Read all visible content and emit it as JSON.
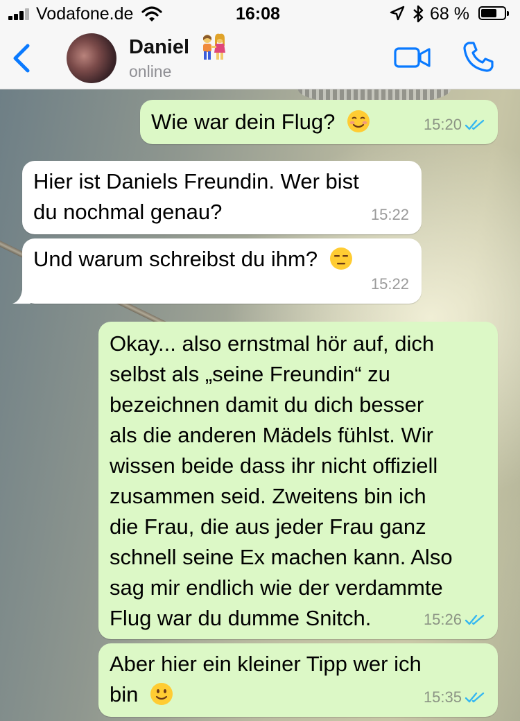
{
  "status_bar": {
    "carrier": "Vodafone.de",
    "time": "16:08",
    "battery_percent": "68 %",
    "battery_level": 0.68,
    "icons": [
      "signal-icon",
      "wifi-icon",
      "location-arrow-icon",
      "bluetooth-icon",
      "battery-icon"
    ]
  },
  "header": {
    "back_icon": "chevron-left-icon",
    "contact_name": "Daniel",
    "name_emoji": "couple-emoji",
    "presence": "online",
    "video_icon": "video-camera-icon",
    "call_icon": "phone-icon",
    "accent_color": "#0a7aff"
  },
  "messages": [
    {
      "direction": "outgoing",
      "lines": [
        "Wie war dein Flug?"
      ],
      "emoji": "smiling-face-emoji",
      "time": "15:20",
      "read": true
    },
    {
      "direction": "incoming",
      "lines": [
        "Hier ist Daniels Freundin. Wer bist",
        "du nochmal genau?"
      ],
      "time": "15:22"
    },
    {
      "direction": "incoming",
      "lines": [
        "Und warum schreibst du ihm?"
      ],
      "emoji": "expressionless-face-emoji",
      "time": "15:22"
    },
    {
      "direction": "outgoing",
      "lines": [
        "Okay... also ernstmal hör auf, dich",
        "selbst als „seine Freundin“ zu",
        "bezeichnen damit du dich besser",
        "als die anderen Mädels fühlst. Wir",
        "wissen beide dass ihr nicht offiziell",
        "zusammen seid. Zweitens bin ich",
        "die Frau, die aus jeder Frau ganz",
        "schnell seine Ex machen kann. Also",
        "sag mir endlich wie der verdammte",
        "Flug war du dumme Snitch."
      ],
      "time": "15:26",
      "read": true
    },
    {
      "direction": "outgoing",
      "lines": [
        "Aber hier ein kleiner Tipp wer ich",
        "bin"
      ],
      "emoji": "slightly-smiling-face-emoji",
      "time": "15:35",
      "read": true
    }
  ],
  "colors": {
    "outgoing_bubble": "#dcf8c6",
    "incoming_bubble": "#ffffff",
    "read_ticks": "#34b7f1"
  }
}
